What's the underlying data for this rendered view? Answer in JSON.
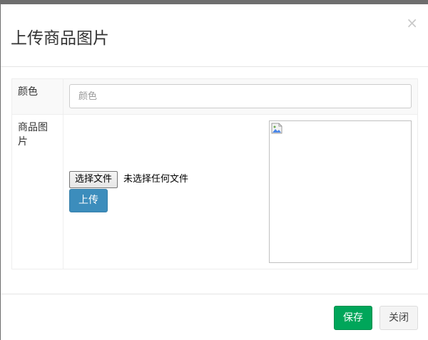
{
  "dialog": {
    "title": "上传商品图片",
    "close_icon": "×"
  },
  "form": {
    "color": {
      "label": "颜色",
      "placeholder": "颜色",
      "value": ""
    },
    "image": {
      "label": "商品图片",
      "file_button_label": "选择文件",
      "file_status": "未选择任何文件",
      "upload_label": "上传",
      "preview_icon": "broken-image-icon"
    }
  },
  "footer": {
    "save_label": "保存",
    "close_label": "关闭"
  },
  "colors": {
    "save_button": "#00a65a",
    "upload_button": "#3c8dbc",
    "close_button": "#f4f4f4"
  }
}
